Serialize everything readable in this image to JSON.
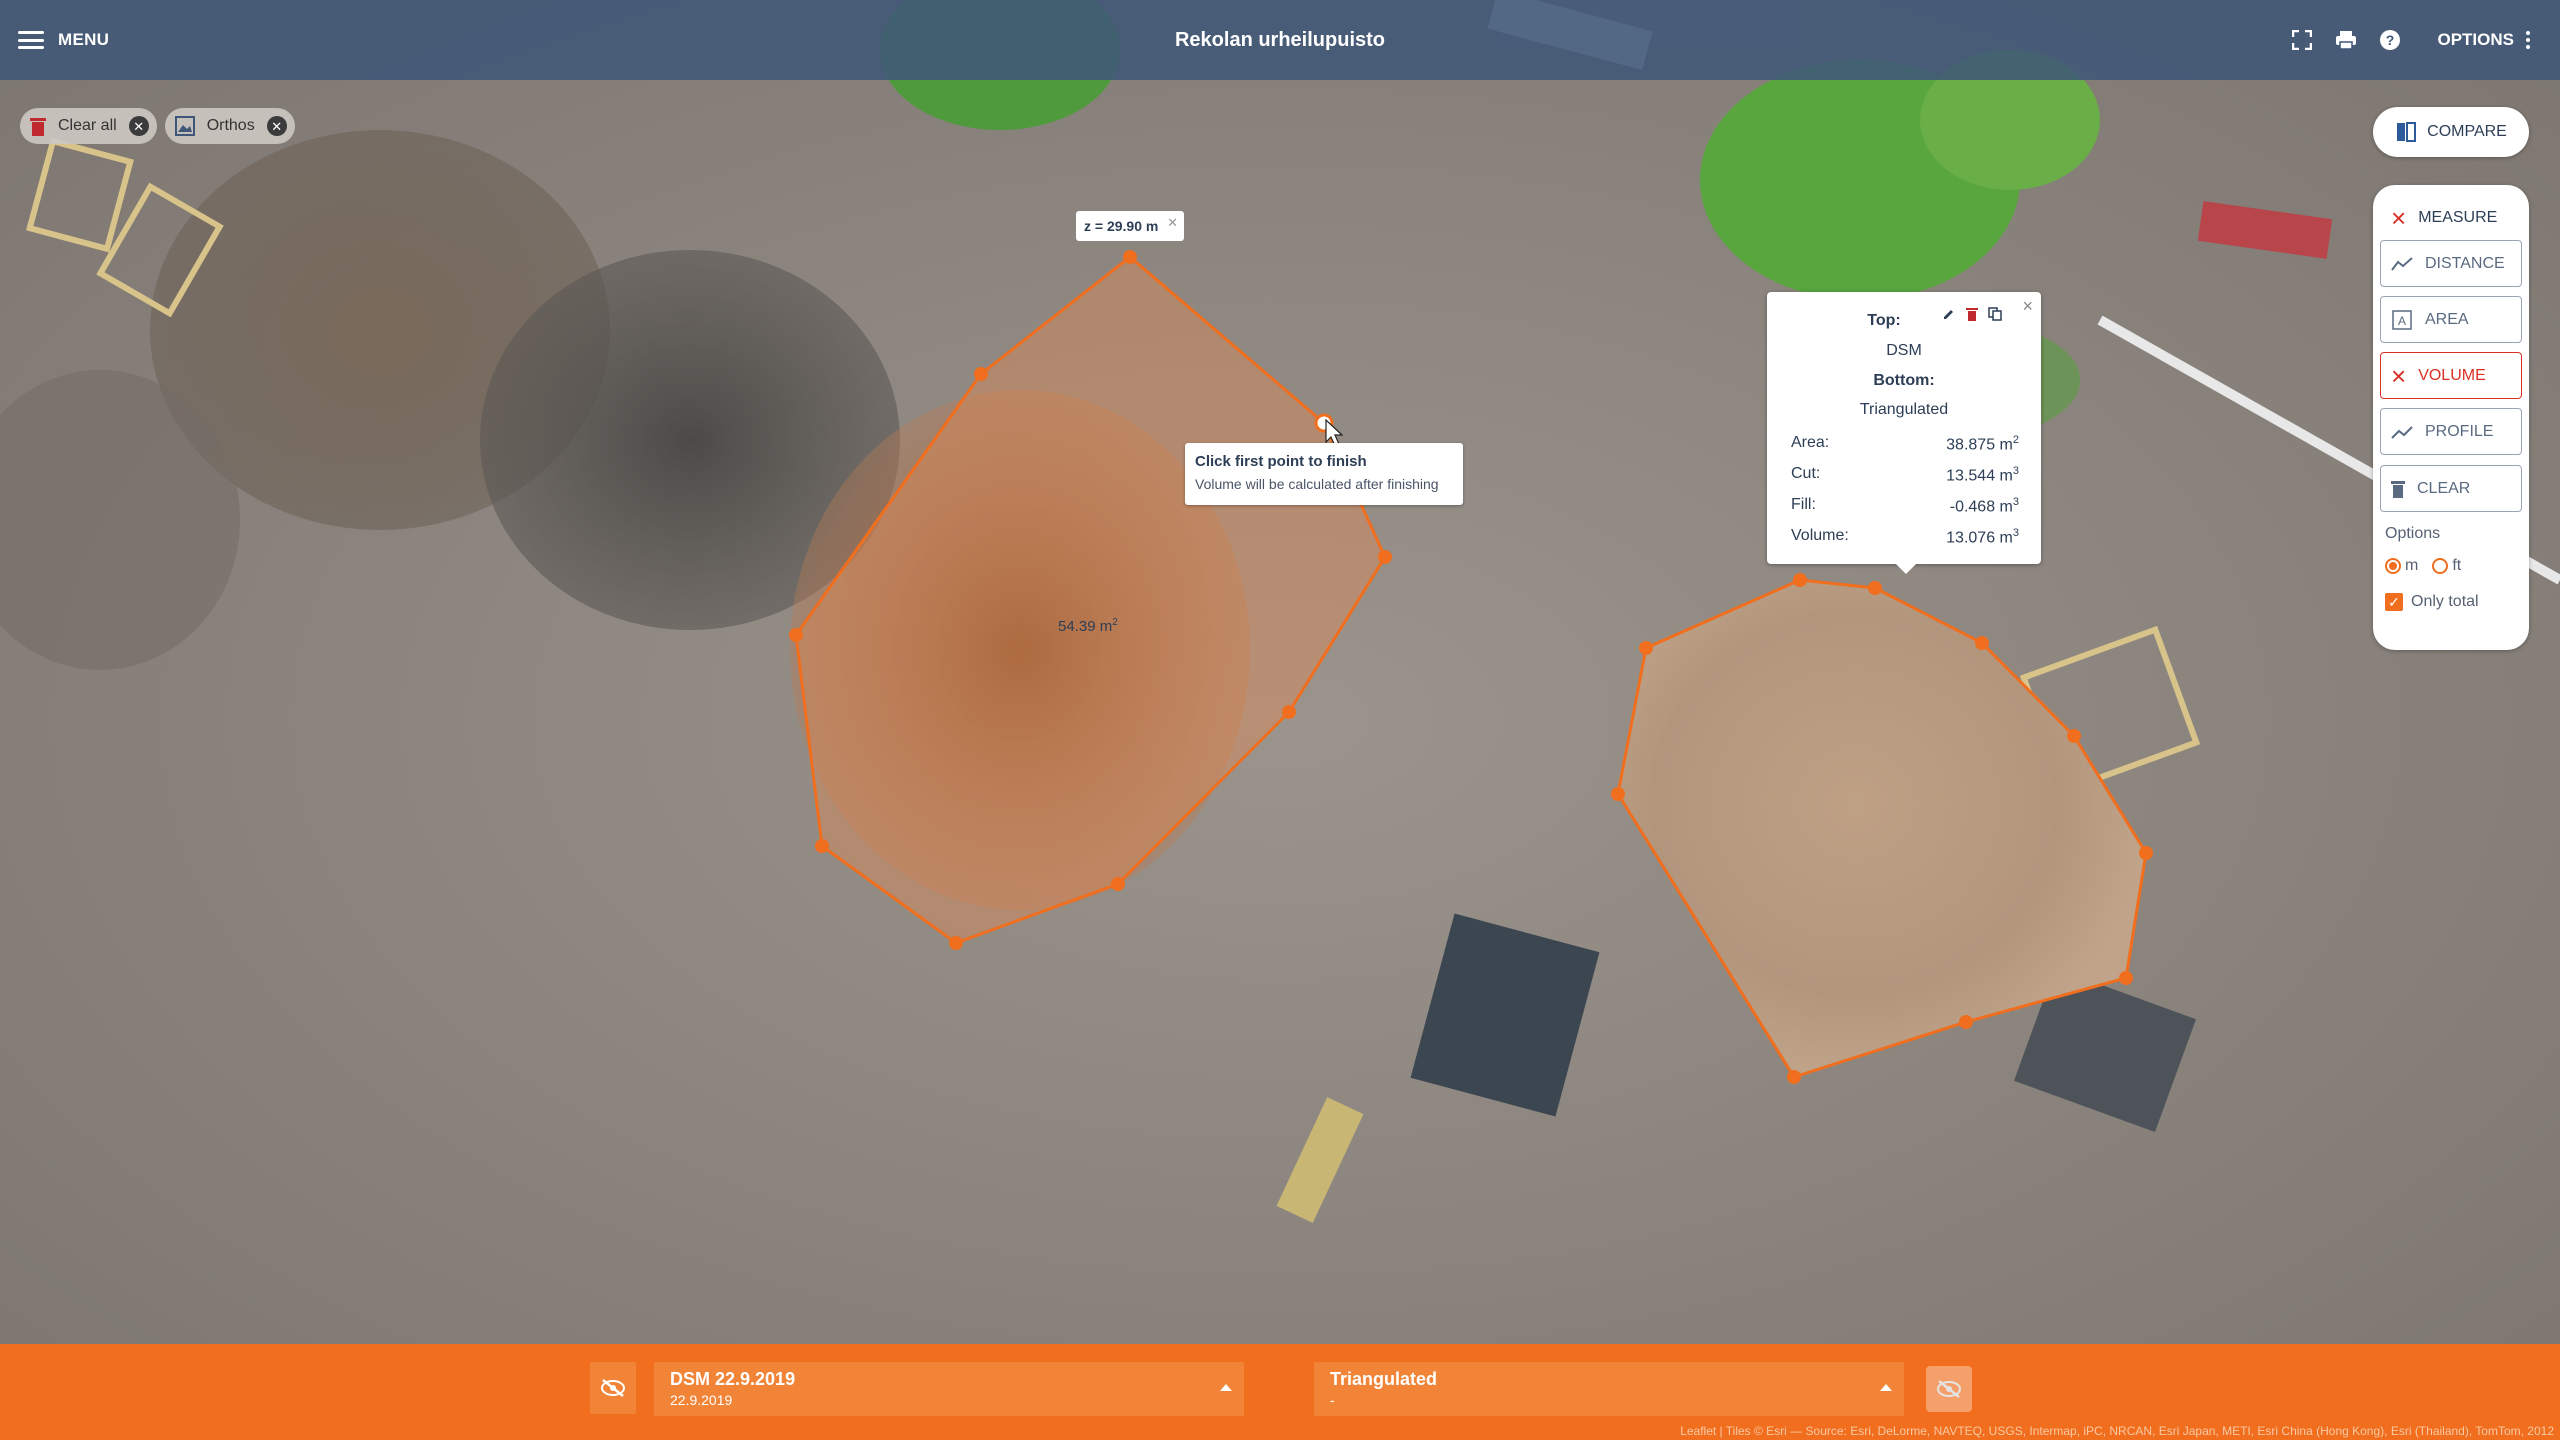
{
  "topbar": {
    "menu_label": "MENU",
    "title": "Rekolan urheilupuisto",
    "options_label": "OPTIONS",
    "icons": [
      "fullscreen-icon",
      "print-icon",
      "help-icon",
      "more-vert-icon"
    ]
  },
  "chips": [
    {
      "label": "Clear all",
      "icon": "trash-icon"
    },
    {
      "label": "Orthos",
      "icon": "image-icon"
    }
  ],
  "compare": {
    "label": "COMPARE"
  },
  "tools": {
    "measure": "MEASURE",
    "distance": "DISTANCE",
    "area": "AREA",
    "volume": "VOLUME",
    "profile": "PROFILE",
    "clear": "CLEAR",
    "options_title": "Options",
    "unit_m": "m",
    "unit_ft": "ft",
    "selected_unit": "m",
    "only_total": "Only total",
    "only_total_checked": true
  },
  "map": {
    "z_label": "z = 29.90 m",
    "hint_title": "Click first point to finish",
    "hint_body": "Volume will be calculated after finishing",
    "area_label": "54.39 m",
    "area_sup": "2"
  },
  "volume_popup": {
    "top_label": "Top:",
    "top_value": "DSM",
    "bottom_label": "Bottom:",
    "bottom_value": "Triangulated",
    "area_label": "Area:",
    "area_value": "38.875 m",
    "area_sup": "2",
    "cut_label": "Cut:",
    "cut_value": "13.544 m",
    "cut_sup": "3",
    "fill_label": "Fill:",
    "fill_value": "-0.468 m",
    "fill_sup": "3",
    "volume_label": "Volume:",
    "volume_value": "13.076 m",
    "volume_sup": "3"
  },
  "bottombar": {
    "top_layer_name": "DSM 22.9.2019",
    "top_layer_date": "22.9.2019",
    "bottom_layer_name": "Triangulated",
    "bottom_layer_sub": "-",
    "attribution": "Leaflet | Tiles © Esri — Source: Esri, DeLorme, NAVTEQ, USGS, Intermap, iPC, NRCAN, Esri Japan, METI, Esri China (Hong Kong), Esri (Thailand), TomTom, 2012"
  },
  "colors": {
    "accent": "#f06e1d",
    "topbar": "#3e5678",
    "danger": "#d93025",
    "text": "#2d3e56"
  }
}
